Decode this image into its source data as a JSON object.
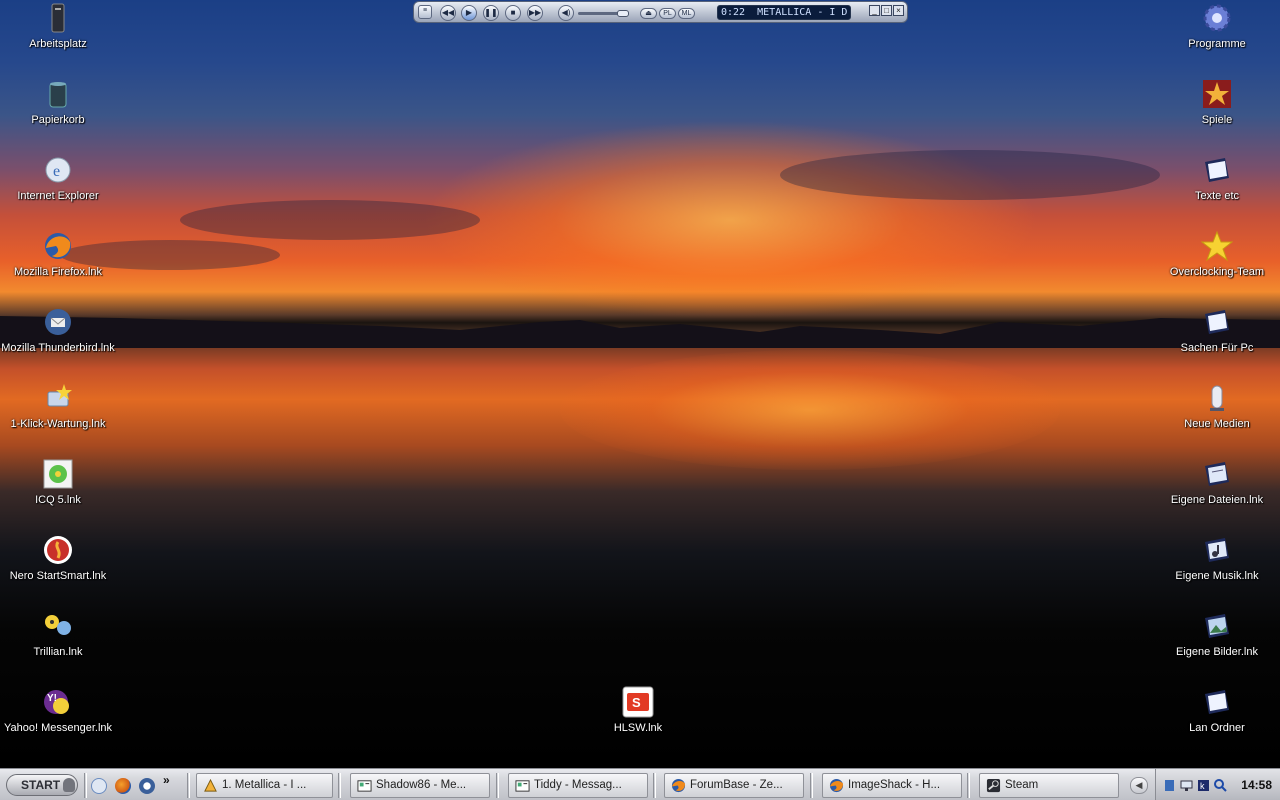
{
  "desktop": {
    "left_icons": [
      {
        "label": "Arbeitsplatz",
        "icon": "computer-icon"
      },
      {
        "label": "Papierkorb",
        "icon": "recycle-bin-icon"
      },
      {
        "label": "Internet Explorer",
        "icon": "internet-explorer-icon"
      },
      {
        "label": "Mozilla Firefox.lnk",
        "icon": "firefox-icon"
      },
      {
        "label": "Mozilla Thunderbird.lnk",
        "icon": "thunderbird-icon"
      },
      {
        "label": "1-Klick-Wartung.lnk",
        "icon": "maintenance-icon"
      },
      {
        "label": "ICQ 5.lnk",
        "icon": "icq-icon"
      },
      {
        "label": "Nero StartSmart.lnk",
        "icon": "nero-icon"
      },
      {
        "label": "Trillian.lnk",
        "icon": "trillian-icon"
      },
      {
        "label": "Yahoo! Messenger.lnk",
        "icon": "yahoo-messenger-icon"
      }
    ],
    "right_icons": [
      {
        "label": "Programme",
        "icon": "gear-icon"
      },
      {
        "label": "Spiele",
        "icon": "star-folder-icon"
      },
      {
        "label": "Texte etc",
        "icon": "folder-icon"
      },
      {
        "label": "Overclocking-Team",
        "icon": "star-icon"
      },
      {
        "label": "Sachen Für Pc",
        "icon": "folder-icon"
      },
      {
        "label": "Neue Medien",
        "icon": "media-icon"
      },
      {
        "label": "Eigene Dateien.lnk",
        "icon": "documents-folder-icon"
      },
      {
        "label": "Eigene Musik.lnk",
        "icon": "music-folder-icon"
      },
      {
        "label": "Eigene Bilder.lnk",
        "icon": "pictures-folder-icon"
      },
      {
        "label": "Lan Ordner",
        "icon": "folder-icon"
      }
    ],
    "center_icon": {
      "label": "HLSW.lnk",
      "icon": "hlsw-icon"
    }
  },
  "winamp": {
    "time": "0:22",
    "track": "METALLICA - I D",
    "buttons": {
      "pl": "PL",
      "ml": "ML"
    },
    "window_controls": [
      "_",
      "□",
      "×"
    ]
  },
  "taskbar": {
    "start_label": "START",
    "quick_launch_more": "»",
    "tasks": [
      {
        "label": "1. Metallica - I ...",
        "icon": "winamp-icon"
      },
      {
        "label": "Shadow86 - Me...",
        "icon": "messenger-icon"
      },
      {
        "label": "Tiddy - Messag...",
        "icon": "messenger-icon"
      },
      {
        "label": "ForumBase - Ze...",
        "icon": "firefox-icon"
      },
      {
        "label": "ImageShack - H...",
        "icon": "firefox-icon"
      },
      {
        "label": "Steam",
        "icon": "steam-icon"
      }
    ],
    "clock": "14:58"
  },
  "colors": {
    "taskbar": "#d0d2d8",
    "winamp_display": "#0a1c3c"
  }
}
